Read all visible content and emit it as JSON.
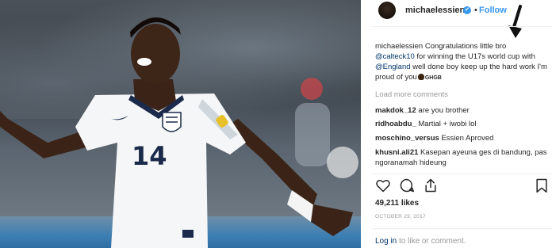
{
  "post": {
    "username": "michaelessien",
    "follow_label": "Follow",
    "separator": "•",
    "verified_icon": "✔"
  },
  "photo": {
    "jersey_number": "14"
  },
  "caption": {
    "username": "michaelessien",
    "text_1": "Congratulations little bro",
    "mention_1": "@calteck10",
    "text_2": "for winning the U17s world cup with",
    "mention_2": "@England",
    "text_3": "well done boy keep up the hard work I'm proud of you",
    "tag": "GHGB"
  },
  "load_more": "Load more comments",
  "comments": [
    {
      "user": "makdok_12",
      "text": "are you brother"
    },
    {
      "user": "ridhoabdu_",
      "text": "Martial + iwobi lol"
    },
    {
      "user": "moschino_versus",
      "text": "Essien Aproved"
    },
    {
      "user": "khusni.ali21",
      "text": "Kasepan ayeuna ges di bandung, pas ngoranamah hideung"
    }
  ],
  "likes": "49,211 likes",
  "date": "OCTOBER 29, 2017",
  "login": {
    "login_label": "Log in",
    "rest": "to like or comment."
  },
  "colors": {
    "link_blue": "#3897f0",
    "mention_navy": "#003569",
    "muted": "#999999",
    "text": "#262626"
  },
  "icons": [
    "heart-icon",
    "comment-icon",
    "share-icon",
    "bookmark-icon",
    "arrow-down-icon",
    "verified-icon"
  ]
}
